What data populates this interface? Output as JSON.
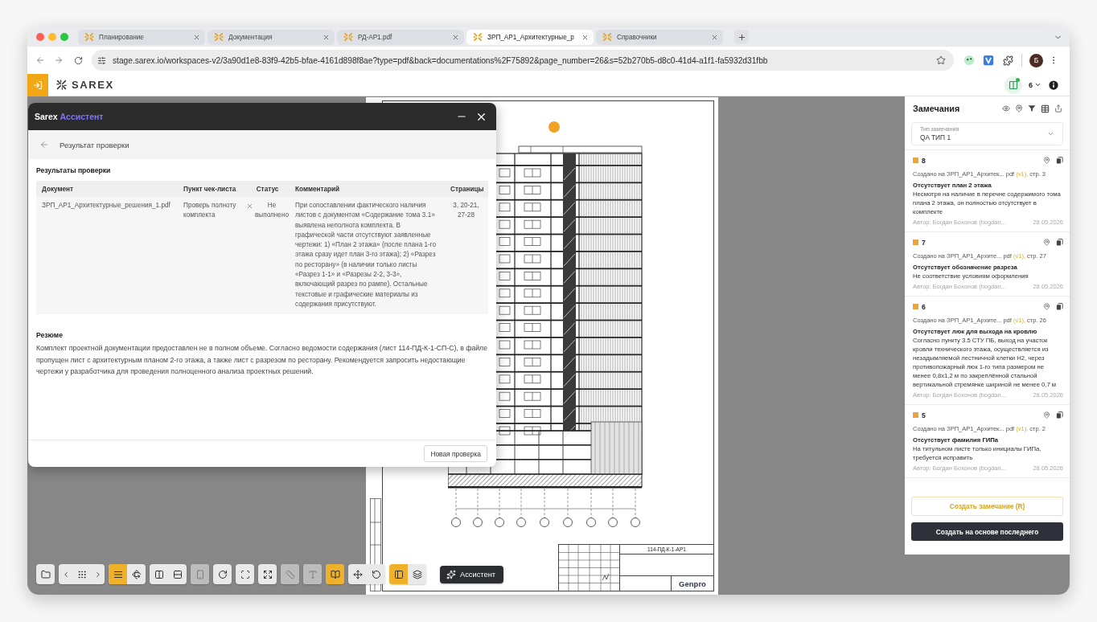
{
  "browser": {
    "tabs": [
      {
        "title": "Планирование",
        "selected": false
      },
      {
        "title": "Документация",
        "selected": false
      },
      {
        "title": "РД-АР1.pdf",
        "selected": false
      },
      {
        "title": "ЗРП_АР1_Архитектурные_р",
        "selected": true
      },
      {
        "title": "Справочники",
        "selected": false
      }
    ],
    "url": "stage.sarex.io/workspaces-v2/3a90d1e8-83f9-42b5-bfae-4161d898f8ae?type=pdf&back=documentations%2F75892&page_number=26&s=52b270b5-d8c0-41d4-a1f1-fa5932d31fbb",
    "profile_initial": "Б"
  },
  "app_header": {
    "logo": "SAREX",
    "version_count": "6"
  },
  "assistant": {
    "brand": "Sarex",
    "name": "Ассистент",
    "page_title": "Результат проверки",
    "results_heading": "Результаты проверки",
    "table": {
      "columns": [
        "Документ",
        "Пункт чек-листа",
        "Статус",
        "Комментарий",
        "Страницы"
      ],
      "rows": [
        {
          "document": "ЗРП_АР1_Архитектурные_решения_1.pdf",
          "checklist_item": "Проверь полноту комплекта",
          "status": {
            "kind": "failed",
            "label": "Не выполнено"
          },
          "comment": "При сопоставлении фактического наличия листов с документом «Содержание тома 3.1» выявлена неполнота комплекта. В графической части отсутствуют заявленные чертежи: 1) «План 2 этажа» (после плана 1-го этажа сразу идет план 3-го этажа); 2) «Разрез по ресторану» (в наличии только листы «Разрез 1-1» и «Разрезы 2-2, 3-3», включающий разрез по рампе). Остальные текстовые и графические материалы из содержания присутствуют.",
          "pages": "3, 20-21, 27-28"
        }
      ]
    },
    "summary_heading": "Резюме",
    "summary": "Комплект проектной документации предоставлен не в полном объеме. Согласно ведомости содержания (лист 114-ПД-К-1-СП-С), в файле пропущен лист с архитектурным планом 2-го этажа, а также лист с разрезом по ресторану. Рекомендуется запросить недостающие чертежи у разработчика для проведения полноценного анализа проектных решений.",
    "new_check_button": "Новая проверка"
  },
  "drawing": {
    "code": "114-ПД-К-1-АР1",
    "company": "Genpro"
  },
  "toolbar": {
    "groups": [
      {
        "buttons": [
          {
            "on": false,
            "disabled": false
          }
        ]
      },
      {
        "buttons": [
          {
            "on": false,
            "disabled": false
          },
          {
            "on": false,
            "disabled": false
          },
          {
            "on": false,
            "disabled": false
          }
        ]
      },
      {
        "buttons": [
          {
            "on": true,
            "disabled": false
          },
          {
            "on": false,
            "disabled": false
          }
        ]
      },
      {
        "buttons": [
          {
            "on": false,
            "disabled": false
          },
          {
            "on": false,
            "disabled": false
          }
        ]
      },
      {
        "buttons": [
          {
            "on": false,
            "disabled": true
          }
        ]
      },
      {
        "buttons": [
          {
            "on": false,
            "disabled": false
          }
        ]
      },
      {
        "buttons": [
          {
            "on": false,
            "disabled": false
          }
        ]
      },
      {
        "buttons": [
          {
            "on": false,
            "disabled": false
          }
        ]
      },
      {
        "buttons": [
          {
            "on": false,
            "disabled": true
          }
        ]
      },
      {
        "buttons": [
          {
            "on": false,
            "disabled": true
          }
        ]
      },
      {
        "buttons": [
          {
            "on": true,
            "disabled": false
          }
        ]
      },
      {
        "buttons": [
          {
            "on": false,
            "disabled": false
          },
          {
            "on": false,
            "disabled": false
          }
        ]
      },
      {
        "buttons": [
          {
            "on": true,
            "disabled": false
          },
          {
            "on": false,
            "disabled": false
          }
        ]
      }
    ],
    "assistant_button": "Ассистент"
  },
  "remarks": {
    "title": "Замечания",
    "type_field": {
      "label": "Тип замечания",
      "value": "QA ТИП 1"
    },
    "items": [
      {
        "number": "8",
        "source": "Создано на ЗРП_АР1_Архитек... pdf",
        "version": "(v1),",
        "page": "стр. 3",
        "title": "Отсутствует план 2 этажа",
        "description": "Несмотря на наличие в перечне содержимого тома плана 2 этажа, он полностью отсутствует в комплекте",
        "author": "Автор: Богдан Бохонов (bogdan...",
        "date": "28.05.2026"
      },
      {
        "number": "7",
        "source": "Создано на ЗРП_АР1_Архите... pdf",
        "version": "(v1),",
        "page": "стр. 27",
        "title": "Отсутствует обозначение разреза",
        "description": "Не соответствие условиям оформления",
        "author": "Автор: Богдан Бохонов (bogdan...",
        "date": "28.05.2026"
      },
      {
        "number": "6",
        "source": "Создано на ЗРП_АР1_Архите... pdf",
        "version": "(v1),",
        "page": "стр. 26",
        "title": "Отсутствует люк для выхода на кровлю",
        "description": "Согласно пункту 3.5 СТУ ПБ, выход на участок кровли технического этажа, осуществляется из незадымляемой лестничной клетки Н2, через противопожарный люк 1-го типа размером не менее 0,8х1,2 м по закреплённой стальной вертикальной стремянке шириной не менее 0,7 м",
        "author": "Автор: Богдан Бохонов (bogdan...",
        "date": "28.05.2026"
      },
      {
        "number": "5",
        "source": "Создано на ЗРП_АР1_Архитек... pdf",
        "version": "(v1),",
        "page": "стр. 2",
        "title": "Отсутствует фамилия ГИПа",
        "description": "На титульном листе только инициалы ГИПа, требуется исправить",
        "author": "Автор: Богдан Бохонов (bogdan...",
        "date": "28.05.2026"
      }
    ],
    "create_button": "Создать замечание (R)",
    "create_from_last_button": "Создать на основе последнего"
  }
}
